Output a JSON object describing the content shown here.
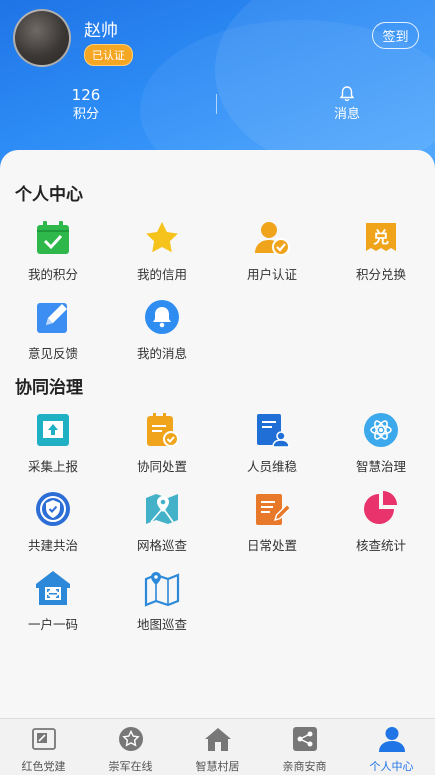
{
  "profile": {
    "name": "赵帅",
    "badge": "已认证",
    "signin_label": "签到"
  },
  "stats": {
    "points_value": "126",
    "points_label": "积分",
    "messages_label": "消息"
  },
  "personal_center": {
    "title": "个人中心",
    "items": [
      {
        "label": "我的积分",
        "icon": "calendar-check-icon"
      },
      {
        "label": "我的信用",
        "icon": "star-icon"
      },
      {
        "label": "用户认证",
        "icon": "user-verified-icon"
      },
      {
        "label": "积分兑换",
        "icon": "exchange-ticket-icon"
      },
      {
        "label": "意见反馈",
        "icon": "edit-pencil-icon"
      },
      {
        "label": "我的消息",
        "icon": "bell-icon"
      }
    ]
  },
  "co_governance": {
    "title": "协同治理",
    "items": [
      {
        "label": "采集上报",
        "icon": "upload-icon"
      },
      {
        "label": "协同处置",
        "icon": "clipboard-check-icon"
      },
      {
        "label": "人员维稳",
        "icon": "people-document-icon"
      },
      {
        "label": "智慧治理",
        "icon": "atom-icon"
      },
      {
        "label": "共建共治",
        "icon": "shield-check-icon"
      },
      {
        "label": "网格巡查",
        "icon": "map-pin-icon"
      },
      {
        "label": "日常处置",
        "icon": "note-edit-icon"
      },
      {
        "label": "核查统计",
        "icon": "pie-chart-icon"
      },
      {
        "label": "一户一码",
        "icon": "house-code-icon"
      },
      {
        "label": "地图巡查",
        "icon": "map-icon"
      }
    ]
  },
  "tabbar": [
    {
      "label": "红色党建",
      "icon": "party-flag-icon"
    },
    {
      "label": "崇军在线",
      "icon": "star-circle-icon"
    },
    {
      "label": "智慧村居",
      "icon": "house-icon"
    },
    {
      "label": "亲商安商",
      "icon": "share-box-icon"
    },
    {
      "label": "个人中心",
      "icon": "person-icon",
      "active": true
    }
  ],
  "colors": {
    "primary": "#1f74e6",
    "green": "#2eb84b",
    "orange": "#f5a623",
    "red": "#e8336d"
  }
}
